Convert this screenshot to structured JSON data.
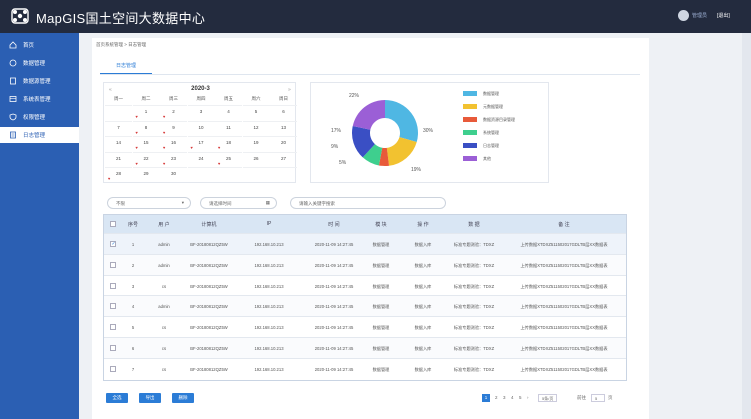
{
  "app": {
    "title": "MapGIS国土空间大数据中心",
    "user": "管理员",
    "logout": "[退出]"
  },
  "sidebar": {
    "items": [
      {
        "label": "首页",
        "icon": "home-icon"
      },
      {
        "label": "数据管理",
        "icon": "database-icon"
      },
      {
        "label": "数据源管理",
        "icon": "document-icon"
      },
      {
        "label": "系统表管理",
        "icon": "table-icon"
      },
      {
        "label": "权限管理",
        "icon": "shield-icon"
      },
      {
        "label": "日志管理",
        "icon": "log-icon",
        "active": true
      }
    ]
  },
  "breadcrumb": "首页系统管理 > 日志管理",
  "tab": "日志管理",
  "calendar": {
    "title": "2020-3",
    "prev": "«",
    "next": "»",
    "weekdays": [
      "周一",
      "周二",
      "周三",
      "周四",
      "周五",
      "周六",
      "周日"
    ],
    "weeks": [
      [
        "",
        "1",
        "2",
        "3",
        "4",
        "5",
        "6"
      ],
      [
        "7",
        "8",
        "9",
        "10",
        "11",
        "12",
        "13"
      ],
      [
        "14",
        "15",
        "16",
        "17",
        "18",
        "19",
        "20"
      ],
      [
        "21",
        "22",
        "23",
        "24",
        "25",
        "26",
        "27"
      ],
      [
        "28",
        "29",
        "30",
        "",
        "",
        "",
        ""
      ]
    ],
    "marked": [
      "1",
      "2",
      "8",
      "9",
      "15",
      "16",
      "17",
      "18",
      "22",
      "23",
      "25",
      "28"
    ]
  },
  "chart_data": {
    "type": "pie",
    "donut": true,
    "slices": [
      {
        "label": "数据管理",
        "value": 30,
        "color": "#4fb7e3"
      },
      {
        "label": "元数据管理",
        "value": 19,
        "color": "#f2c230"
      },
      {
        "label": "数据资源目录管理",
        "value": 5,
        "color": "#e85a3a"
      },
      {
        "label": "系统管理",
        "value": 9,
        "color": "#3ecf8e"
      },
      {
        "label": "日志管理",
        "value": 17,
        "color": "#3a4fc4"
      },
      {
        "label": "其他",
        "value": 22,
        "color": "#9b5fd6"
      }
    ],
    "percent_labels": [
      "22%",
      "30%",
      "19%",
      "5%",
      "9%",
      "17%"
    ]
  },
  "filters": {
    "type_select": "不限",
    "date_placeholder": "请选择时间",
    "search_placeholder": "请输入关键字搜索"
  },
  "table": {
    "headers": [
      "序号",
      "用 户",
      "计算机",
      "IP",
      "时 间",
      "模 块",
      "操 作",
      "数 据",
      "备 注"
    ],
    "rows": [
      [
        "1",
        "admin",
        "BF-20180812QZ5W",
        "192.168.10.213",
        "2020-11-09  14:27:45",
        "数据管理",
        "数据入库",
        "标准专题测验：TDXZ",
        "上传数据XTDXZ511502017GDLTB层XX数据表"
      ],
      [
        "2",
        "admin",
        "BF-20180812QZ5W",
        "192.168.10.213",
        "2020-11-09  14:27:45",
        "数据管理",
        "数据入库",
        "标准专题测验：TDXZ",
        "上传数据XTDXZ511502017GDLTB层XX数据表"
      ],
      [
        "3",
        "cs",
        "BF-20180812QZ5W",
        "192.168.10.213",
        "2020-11-09  14:27:45",
        "数据管理",
        "数据入库",
        "标准专题测验：TDXZ",
        "上传数据XTDXZ511502017GDLTB层XX数据表"
      ],
      [
        "4",
        "admin",
        "BF-20180812QZ5W",
        "192.168.10.213",
        "2020-11-09  14:27:45",
        "数据管理",
        "数据入库",
        "标准专题测验：TDXZ",
        "上传数据XTDXZ511502017GDLTB层XX数据表"
      ],
      [
        "5",
        "cs",
        "BF-20180812QZ5W",
        "192.168.10.213",
        "2020-11-09  14:27:45",
        "数据管理",
        "数据入库",
        "标准专题测验：TDXZ",
        "上传数据XTDXZ511502017GDLTB层XX数据表"
      ],
      [
        "6",
        "cs",
        "BF-20180812QZ5W",
        "192.168.10.213",
        "2020-11-09  14:27:45",
        "数据管理",
        "数据入库",
        "标准专题测验：TDXZ",
        "上传数据XTDXZ511502017GDLTB层XX数据表"
      ],
      [
        "7",
        "cs",
        "BF-20180812QZ5W",
        "192.168.10.213",
        "2020-11-09  14:27:45",
        "数据管理",
        "数据入库",
        "标准专题测验：TDXZ",
        "上传数据XTDXZ511502017GDLTB层XX数据表"
      ]
    ]
  },
  "actions": {
    "select_all": "全选",
    "export": "导出",
    "delete": "删除"
  },
  "pagination": {
    "pages": [
      "1",
      "2",
      "3",
      "4",
      "5"
    ],
    "next": "›",
    "per_page": "5条/页",
    "goto_label": "前往",
    "goto_value": "5",
    "page_suffix": "页"
  }
}
